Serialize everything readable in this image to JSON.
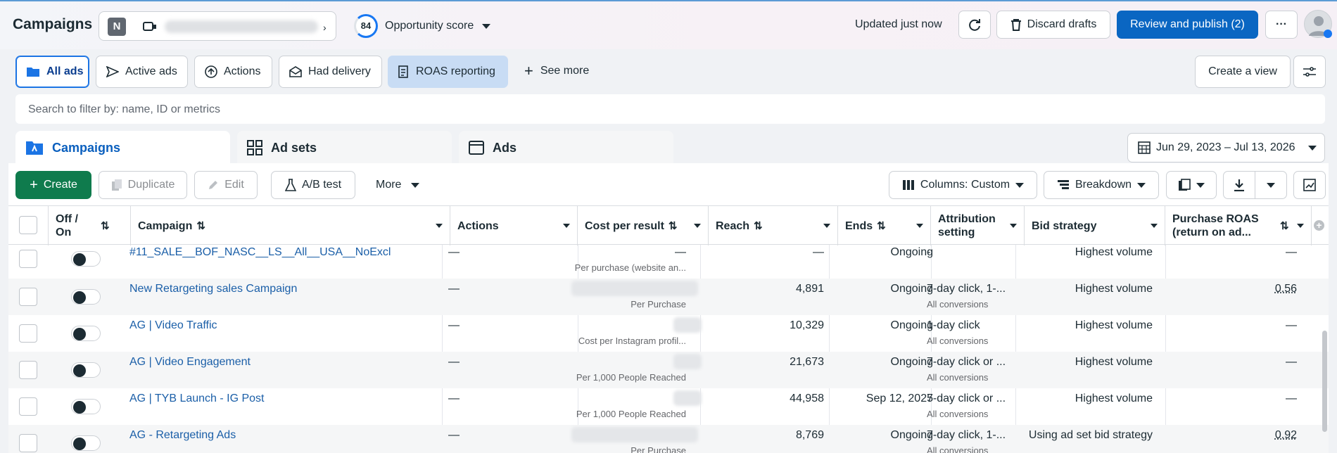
{
  "header": {
    "title": "Campaigns",
    "account_initial": "N",
    "opportunity_score": "84",
    "opportunity_label": "Opportunity score",
    "updated": "Updated just now",
    "discard": "Discard drafts",
    "publish": "Review and publish (2)"
  },
  "view_tabs": {
    "all_ads": "All ads",
    "active_ads": "Active ads",
    "actions": "Actions",
    "had_delivery": "Had delivery",
    "roas": "ROAS reporting",
    "see_more": "See more",
    "create_view": "Create a view"
  },
  "search": {
    "placeholder": "Search to filter by: name, ID or metrics"
  },
  "levels": {
    "campaigns": "Campaigns",
    "adsets": "Ad sets",
    "ads": "Ads"
  },
  "date_range": "Jun 29, 2023 – Jul 13, 2026",
  "toolbar": {
    "create": "Create",
    "duplicate": "Duplicate",
    "edit": "Edit",
    "ab_test": "A/B test",
    "more": "More",
    "columns": "Columns: Custom",
    "breakdown": "Breakdown"
  },
  "columns": {
    "off_on": "Off / On",
    "campaign": "Campaign",
    "actions": "Actions",
    "cost_per_result": "Cost per result",
    "reach": "Reach",
    "ends": "Ends",
    "attribution": "Attribution setting",
    "bid": "Bid strategy",
    "roas": "Purchase ROAS (return on ad..."
  },
  "rows": [
    {
      "name": "#11_SALE__BOF_NASC__LS__All__USA__NoExcl",
      "actions": "—",
      "cost": "—",
      "cost_sub": "Per purchase (website an...",
      "reach": "—",
      "ends": "Ongoing",
      "attr": "-",
      "attr_sub": "",
      "bid": "Highest volume",
      "roas": "—"
    },
    {
      "name": "New Retargeting sales Campaign",
      "actions": "—",
      "cost": "",
      "cost_sub": "Per Purchase",
      "reach": "4,891",
      "ends": "Ongoing",
      "attr": "7-day click, 1-...",
      "attr_sub": "All conversions",
      "bid": "Highest volume",
      "roas": "0.56"
    },
    {
      "name": "AG | Video Traffic",
      "actions": "—",
      "cost": "",
      "cost_sub": "Cost per Instagram profil...",
      "reach": "10,329",
      "ends": "Ongoing",
      "attr": "1-day click",
      "attr_sub": "All conversions",
      "bid": "Highest volume",
      "roas": "—"
    },
    {
      "name": "AG | Video Engagement",
      "actions": "—",
      "cost": "",
      "cost_sub": "Per 1,000 People Reached",
      "reach": "21,673",
      "ends": "Ongoing",
      "attr": "7-day click or ...",
      "attr_sub": "All conversions",
      "bid": "Highest volume",
      "roas": "—"
    },
    {
      "name": "AG | TYB Launch - IG Post",
      "actions": "—",
      "cost": "",
      "cost_sub": "Per 1,000 People Reached",
      "reach": "44,958",
      "ends": "Sep 12, 2025",
      "attr": "7-day click or ...",
      "attr_sub": "All conversions",
      "bid": "Highest volume",
      "roas": "—"
    },
    {
      "name": "AG - Retargeting Ads",
      "actions": "—",
      "cost": "",
      "cost_sub": "Per Purchase",
      "reach": "8,769",
      "ends": "Ongoing",
      "attr": "7-day click, 1-...",
      "attr_sub": "All conversions",
      "bid": "Using ad set bid strategy",
      "roas": "0.92"
    }
  ],
  "colors": {
    "primary": "#0a66c2",
    "create": "#0f7b4d",
    "link": "#1b5fa8",
    "roas_tab": "#c8dcf4"
  }
}
